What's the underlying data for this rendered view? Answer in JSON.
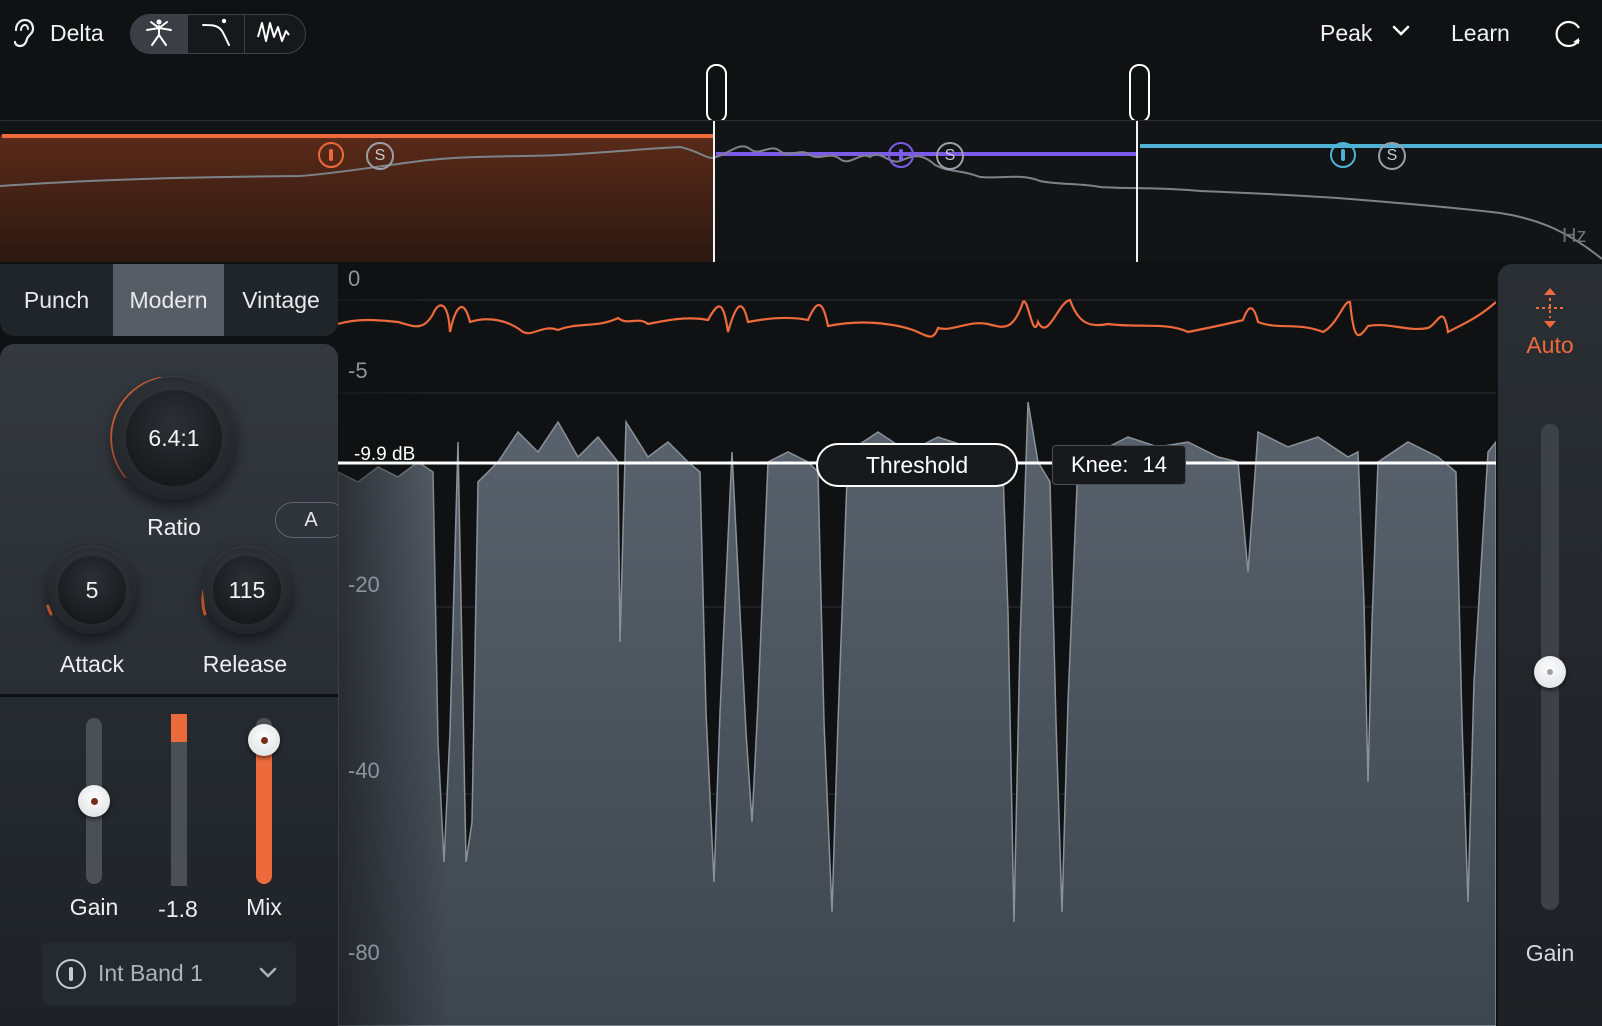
{
  "topbar": {
    "delta_label": "Delta",
    "meter_mode": "Peak",
    "learn_label": "Learn",
    "icons": [
      "ear-icon",
      "figure-mode-icon",
      "curve-mode-icon",
      "wave-mode-icon",
      "chevron-down-icon",
      "refresh-icon"
    ]
  },
  "band_strip": {
    "bands": [
      {
        "color": "#ec6a3c",
        "solo_label": "S"
      },
      {
        "color": "#7b5be8",
        "solo_label": "S"
      },
      {
        "color": "#4fb1d6",
        "solo_label": "S"
      }
    ],
    "unit_label": "Hz"
  },
  "style_tabs": {
    "items": [
      "Punch",
      "Modern",
      "Vintage"
    ],
    "selected": "Modern"
  },
  "knobs": {
    "ratio": {
      "value": "6.4:1",
      "label": "Ratio"
    },
    "auto_label": "A",
    "attack": {
      "value": "5",
      "label": "Attack"
    },
    "release": {
      "value": "115",
      "label": "Release"
    }
  },
  "faders": {
    "gain_label": "Gain",
    "meter_value": "-1.8",
    "mix_label": "Mix"
  },
  "band_select": {
    "value": "Int Band 1"
  },
  "graph": {
    "db_ticks": [
      "0",
      "-5",
      "-20",
      "-40",
      "-80"
    ],
    "threshold_value": "-9.9 dB",
    "threshold_label": "Threshold",
    "knee_label": "Knee:",
    "knee_value": "14"
  },
  "right_panel": {
    "auto_label": "Auto",
    "gain_label": "Gain"
  },
  "colors": {
    "accent": "#ec6a3c",
    "purple": "#7b5be8",
    "blue": "#4fb1d6",
    "background": "#101113"
  }
}
